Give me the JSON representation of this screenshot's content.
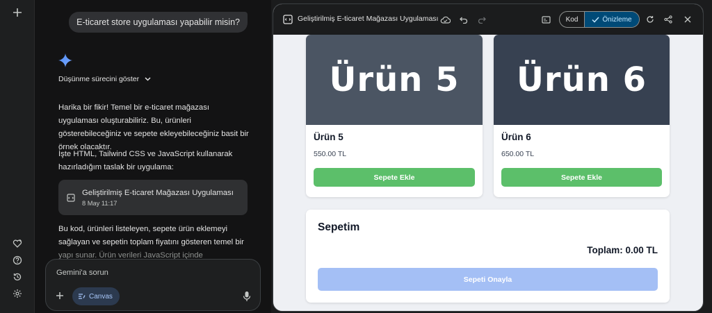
{
  "chat": {
    "user_message": "E-ticaret store uygulaması yapabilir misin?",
    "thinking_toggle": "Düşünme sürecini göster",
    "response_p1": "Harika bir fikir! Temel bir e-ticaret mağazası uygulaması oluşturabiliriz. Bu, ürünleri gösterebileceğiniz ve sepete ekleyebileceğiniz basit bir örnek olacaktır.",
    "response_p2": "İşte HTML, Tailwind CSS ve JavaScript kullanarak hazırladığım taslak bir uygulama:",
    "doc_card": {
      "title": "Geliştirilmiş E-ticaret Mağazası Uygulaması",
      "date": "8 May 11:17"
    },
    "response_p3": "Bu kod, ürünleri listeleyen, sepete ürün eklemeyi sağlayan ve sepetin toplam fiyatını gösteren temel bir",
    "response_p3_faded": "yapı sunar. Ürün verileri JavaScript içinde",
    "input": {
      "placeholder": "Gemini'a sorun",
      "canvas_label": "Canvas"
    }
  },
  "canvas": {
    "title": "Geliştirilmiş E-ticaret Mağazası Uygulaması",
    "toggle": {
      "code_label": "Kod",
      "preview_label": "Önizleme",
      "active": "preview"
    }
  },
  "store": {
    "products": [
      {
        "image_text": "Ürün 5",
        "name": "Ürün 5",
        "price": "550.00 TL",
        "button": "Sepete Ekle",
        "bg": "#4b5563"
      },
      {
        "image_text": "Ürün 6",
        "name": "Ürün 6",
        "price": "650.00 TL",
        "button": "Sepete Ekle",
        "bg": "#374151"
      }
    ],
    "cart": {
      "title": "Sepetim",
      "total": "Toplam: 0.00 TL",
      "confirm_button": "Sepeti Onayla"
    }
  },
  "icons": {
    "rail": [
      "plus-icon",
      "gem-heart-icon",
      "help-icon",
      "history-icon",
      "settings-icon"
    ],
    "toolbar": [
      "document-icon",
      "cloud-save-icon",
      "undo-icon",
      "redo-icon",
      "console-icon",
      "refresh-icon",
      "share-icon",
      "close-icon"
    ]
  },
  "colors": {
    "accent_green": "#5cbf6a",
    "confirm_disabled": "#a4bff5",
    "preview_active": "#004a77"
  }
}
